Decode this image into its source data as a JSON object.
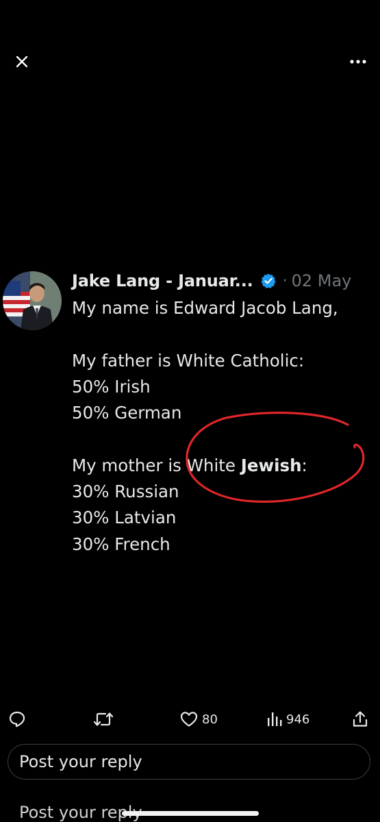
{
  "toolbar": {
    "close_icon": "close-icon",
    "more_icon": "more-icon"
  },
  "tweet": {
    "author": "Jake Lang - Januar...",
    "verified_icon": "verified-badge-icon",
    "separator": "·",
    "date": "02 May",
    "lines": [
      "My name is Edward Jacob Lang,",
      "",
      "My father is White Catholic:",
      "50% Irish",
      "50% German",
      "",
      "My mother is White ",
      "30% Russian",
      "30% Latvian",
      "30% French"
    ],
    "mother_line_bold": "Jewish",
    "mother_line_end": ":",
    "annotation_color": "#e0262a"
  },
  "actions": {
    "reply_icon": "reply-icon",
    "retweet_icon": "retweet-icon",
    "like_icon": "heart-icon",
    "like_count": "80",
    "views_icon": "views-icon",
    "views_count": "946",
    "share_icon": "share-icon"
  },
  "reply": {
    "placeholder": "Post your reply",
    "ghost_text": "Post your reply"
  },
  "colors": {
    "background": "#000000",
    "text": "#e7e9ea",
    "muted": "#71767b",
    "verified": "#1d9bf0"
  }
}
